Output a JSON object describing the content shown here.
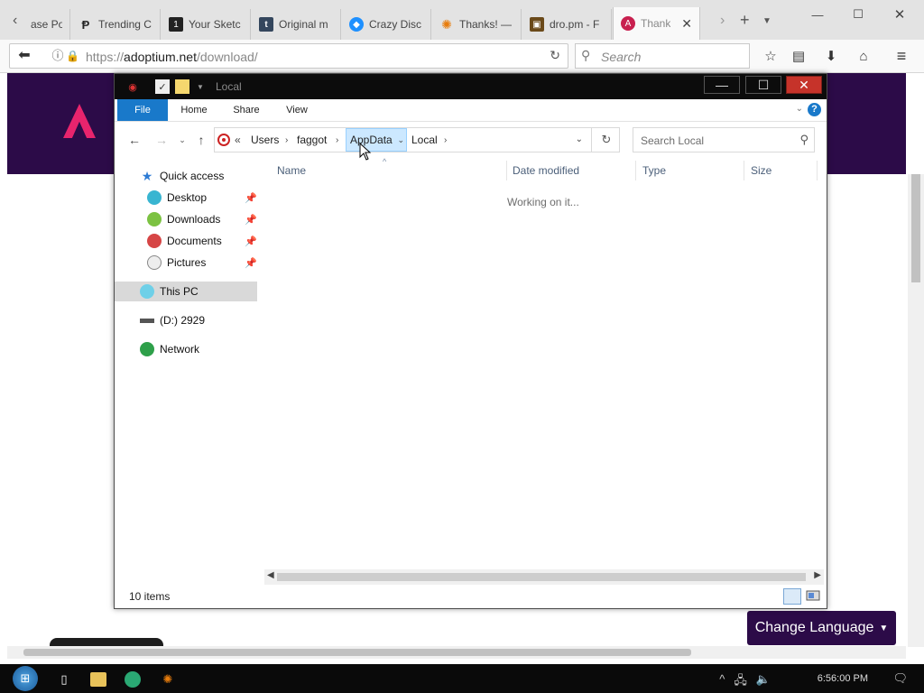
{
  "browser": {
    "tabs": [
      {
        "label": "ase Po",
        "favicon": "page-icon",
        "color": "#666666"
      },
      {
        "label": "Trending C",
        "favicon": "p-logo-icon",
        "color": "#222222"
      },
      {
        "label": "Your Sketc",
        "favicon": "one-logo-icon",
        "color": "#222222"
      },
      {
        "label": "Original m",
        "favicon": "tumblr-icon",
        "color": "#34465d"
      },
      {
        "label": "Crazy Disc",
        "favicon": "crazy-disc-icon",
        "color": "#1e90ff"
      },
      {
        "label": "Thanks! —",
        "favicon": "blender-icon",
        "color": "#e87d0d"
      },
      {
        "label": "dro.pm - F",
        "favicon": "dropm-icon",
        "color": "#6b4a1a"
      },
      {
        "label": "Thank",
        "favicon": "adoptium-icon",
        "color": "#c8204f"
      }
    ],
    "new_tab_label": "+",
    "url": {
      "prefix": "https://",
      "domain": "adoptium.net",
      "path": "/download/"
    },
    "search_placeholder": "Search"
  },
  "page": {
    "change_language": "Change Language"
  },
  "explorer": {
    "window_title": "Local",
    "ribbon_tabs": [
      "File",
      "Home",
      "Share",
      "View"
    ],
    "breadcrumb": {
      "overflow": "«",
      "items": [
        "Users",
        "faggot",
        "AppData",
        "Local"
      ]
    },
    "search_placeholder": "Search Local",
    "nav": {
      "quick_access": "Quick access",
      "pinned": [
        "Desktop",
        "Downloads",
        "Documents",
        "Pictures"
      ],
      "this_pc": "This PC",
      "drive": "(D:) 2929",
      "network": "Network"
    },
    "columns": [
      "Name",
      "Date modified",
      "Type",
      "Size"
    ],
    "working_text": "Working on it...",
    "status_count": "10 items"
  },
  "taskbar": {
    "time": "6:56:00 PM"
  },
  "colors": {
    "site_header": "#2c0b48",
    "explorer_file_tab": "#1979ca",
    "breadcrumb_highlight": "#cce8ff",
    "close_button": "#c6332a"
  }
}
